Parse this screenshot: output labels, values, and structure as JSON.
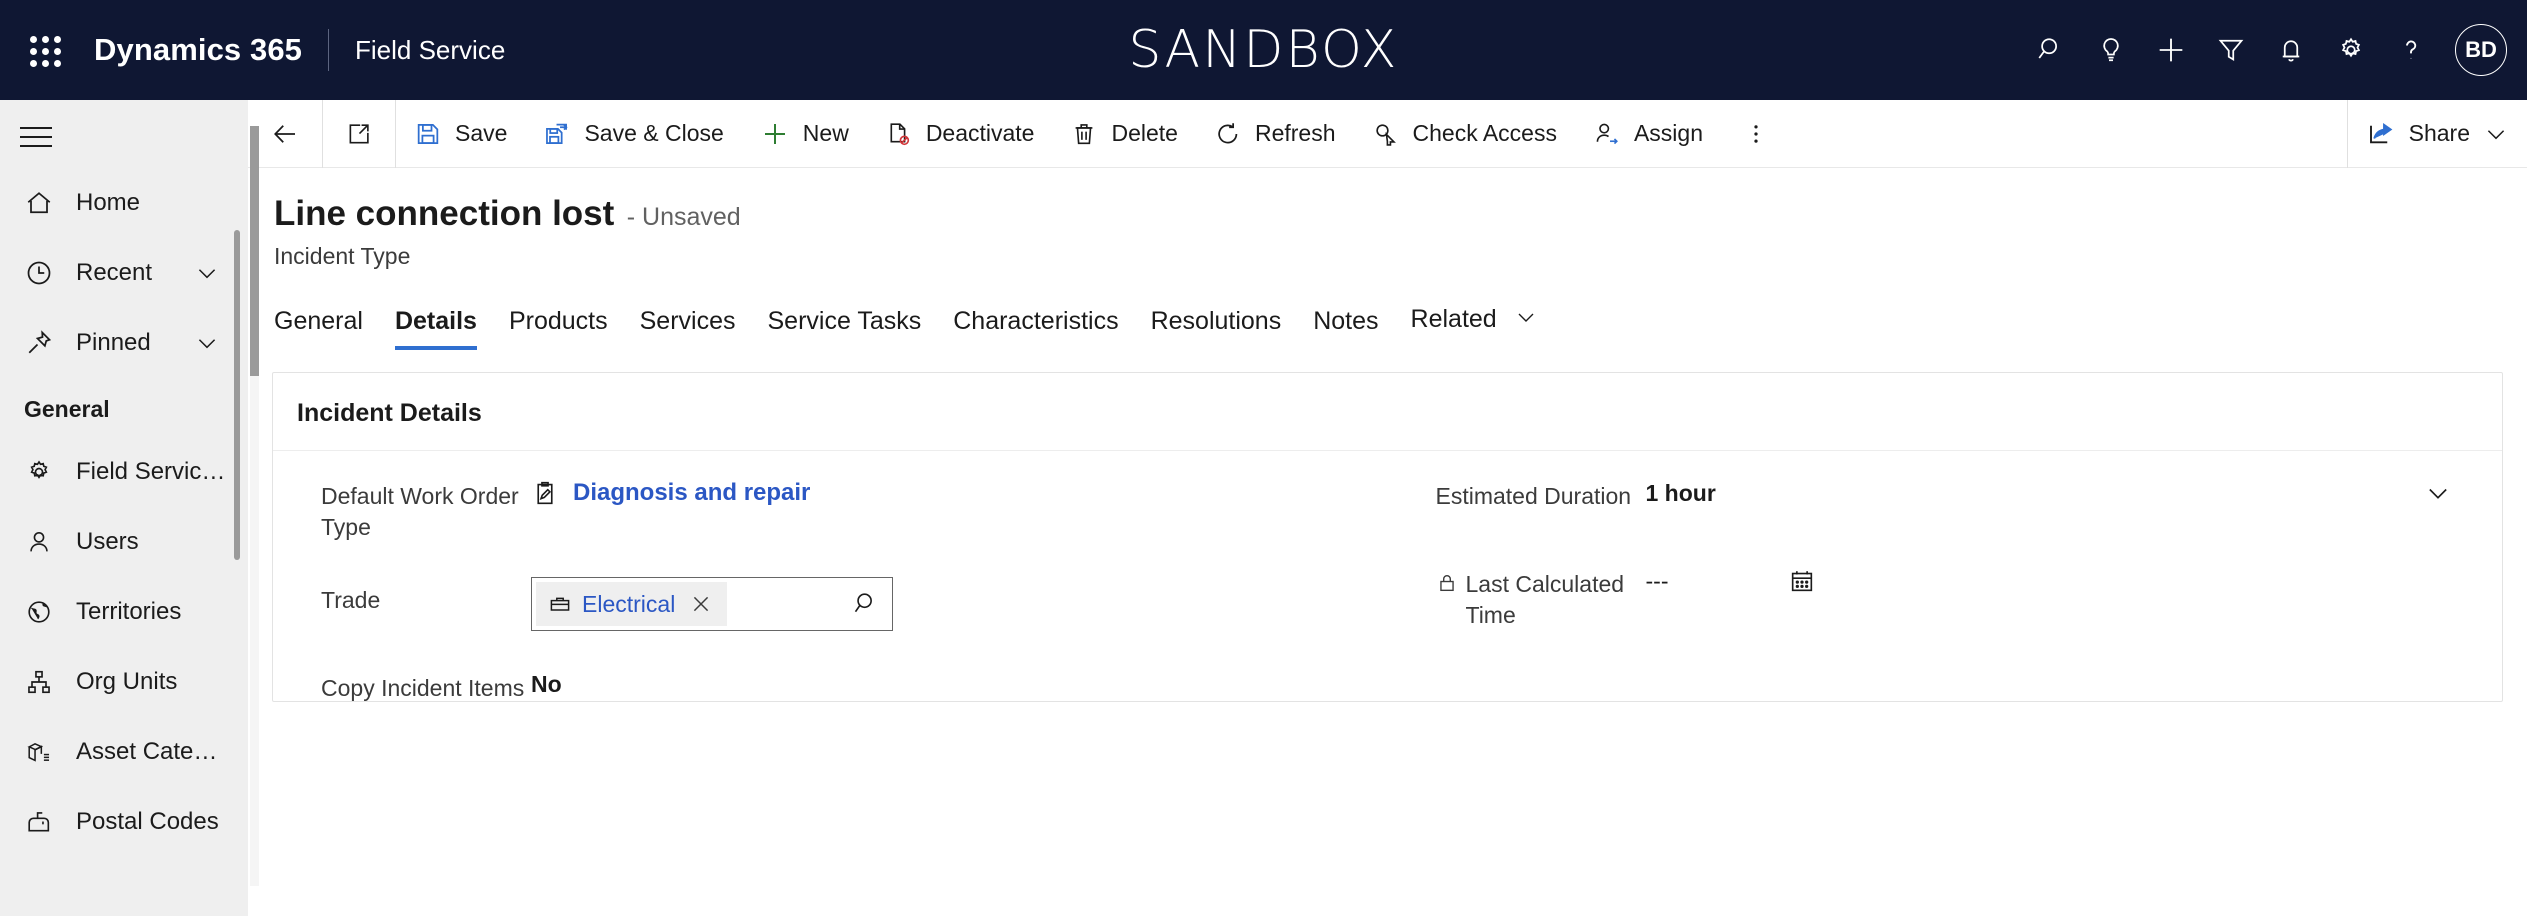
{
  "topnav": {
    "waffle_label": "app-launcher",
    "brand": "Dynamics 365",
    "app_name": "Field Service",
    "env_banner": "SANDBOX",
    "icons": [
      {
        "name": "search-icon",
        "label": "Search"
      },
      {
        "name": "lightbulb-icon",
        "label": "Ideas"
      },
      {
        "name": "plus-icon",
        "label": "Quick create"
      },
      {
        "name": "filter-icon",
        "label": "Filter"
      },
      {
        "name": "bell-icon",
        "label": "Notifications"
      },
      {
        "name": "gear-icon",
        "label": "Settings"
      },
      {
        "name": "question-icon",
        "label": "Help"
      }
    ],
    "avatar_initials": "BD",
    "bg_color": "#0f1733"
  },
  "sidebar": {
    "hamburger_label": "Expand navigation",
    "quick": [
      {
        "label": "Home",
        "icon": "home-icon",
        "chevron": false
      },
      {
        "label": "Recent",
        "icon": "clock-icon",
        "chevron": true
      },
      {
        "label": "Pinned",
        "icon": "pin-icon",
        "chevron": true
      }
    ],
    "group_title": "General",
    "items": [
      {
        "label": "Field Service Setti...",
        "icon": "gear-icon"
      },
      {
        "label": "Users",
        "icon": "person-icon"
      },
      {
        "label": "Territories",
        "icon": "globe-icon"
      },
      {
        "label": "Org Units",
        "icon": "org-chart-icon"
      },
      {
        "label": "Asset Categories",
        "icon": "asset-box-icon"
      },
      {
        "label": "Postal Codes",
        "icon": "mailbox-icon"
      }
    ]
  },
  "commandbar": {
    "back_label": "Back",
    "popout_label": "Open in new window",
    "buttons": [
      {
        "label": "Save",
        "icon": "save-floppy-icon"
      },
      {
        "label": "Save & Close",
        "icon": "save-close-icon"
      },
      {
        "label": "New",
        "icon": "plus-icon"
      },
      {
        "label": "Deactivate",
        "icon": "deactivate-icon"
      },
      {
        "label": "Delete",
        "icon": "trash-icon"
      },
      {
        "label": "Refresh",
        "icon": "refresh-icon"
      },
      {
        "label": "Check Access",
        "icon": "key-icon"
      },
      {
        "label": "Assign",
        "icon": "assign-person-icon"
      }
    ],
    "overflow_label": "More commands",
    "share_label": "Share",
    "accent_blue": "#2f6fd0",
    "accent_green": "#2e7d32"
  },
  "record": {
    "title": "Line connection lost",
    "state": "- Unsaved",
    "entity": "Incident Type"
  },
  "tabs": [
    {
      "label": "General",
      "active": false
    },
    {
      "label": "Details",
      "active": true
    },
    {
      "label": "Products",
      "active": false
    },
    {
      "label": "Services",
      "active": false
    },
    {
      "label": "Service Tasks",
      "active": false
    },
    {
      "label": "Characteristics",
      "active": false
    },
    {
      "label": "Resolutions",
      "active": false
    },
    {
      "label": "Notes",
      "active": false
    },
    {
      "label": "Related",
      "active": false,
      "chevron": true
    }
  ],
  "section": {
    "title": "Incident Details",
    "left_fields": [
      {
        "label": "Default Work Order Type",
        "type": "lookup-link",
        "value": "Diagnosis and repair",
        "icon": "clipboard-pencil-icon"
      },
      {
        "label": "Trade",
        "type": "lookup-input",
        "value": "Electrical",
        "icon": "toolbox-icon",
        "clear_label": "Remove Electrical",
        "search_label": "Lookup records"
      },
      {
        "label": "Copy Incident Items to Agreement",
        "type": "text",
        "value": "No"
      }
    ],
    "right_fields": [
      {
        "label": "Estimated Duration",
        "type": "dropdown",
        "value": "1 hour",
        "locked": false
      },
      {
        "label": "Last Calculated Time",
        "type": "datetime",
        "value": "---",
        "locked": true,
        "lock_icon": "lock-icon",
        "calendar_icon": "calendar-icon"
      }
    ]
  }
}
